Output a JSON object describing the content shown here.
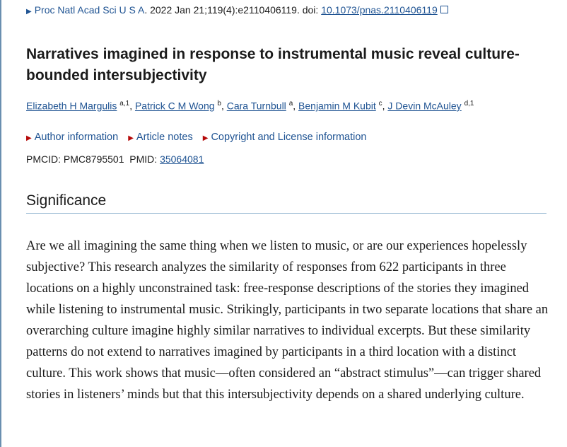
{
  "citation": {
    "journal": "Proc Natl Acad Sci U S A",
    "details": ". 2022 Jan 21;119(4):e2110406119. doi: ",
    "doi": "10.1073/pnas.2110406119"
  },
  "title": "Narratives imagined in response to instrumental music reveal culture-bounded intersubjectivity",
  "authors": [
    {
      "name": "Elizabeth H Margulis",
      "sup": "a,1"
    },
    {
      "name": "Patrick C M Wong",
      "sup": "b"
    },
    {
      "name": "Cara Turnbull",
      "sup": "a"
    },
    {
      "name": "Benjamin M Kubit",
      "sup": "c"
    },
    {
      "name": "J Devin McAuley",
      "sup": "d,1"
    }
  ],
  "notes": {
    "author_info": "Author information",
    "article_notes": "Article notes",
    "copyright": "Copyright and License information"
  },
  "ids": {
    "pmcid_label": "PMCID: PMC8795501",
    "pmid_label": "PMID: ",
    "pmid": "35064081"
  },
  "section": {
    "heading": "Significance",
    "body": "Are we all imagining the same thing when we listen to music, or are our experiences hopelessly subjective? This research analyzes the similarity of responses from 622 participants in three locations on a highly unconstrained task: free-response descriptions of the stories they imagined while listening to instrumental music. Strikingly, participants in two separate locations that share an overarching culture imagine highly similar narratives to individual excerpts. But these similarity patterns do not extend to narratives imagined by participants in a third location with a distinct culture. This work shows that music—often considered an “abstract stimulus”—can trigger shared stories in listeners’ minds but that this intersubjectivity depends on a shared underlying culture."
  },
  "colors": {
    "link": "#205493",
    "arrow": "#b50909",
    "rule": "#8fb2cf"
  }
}
